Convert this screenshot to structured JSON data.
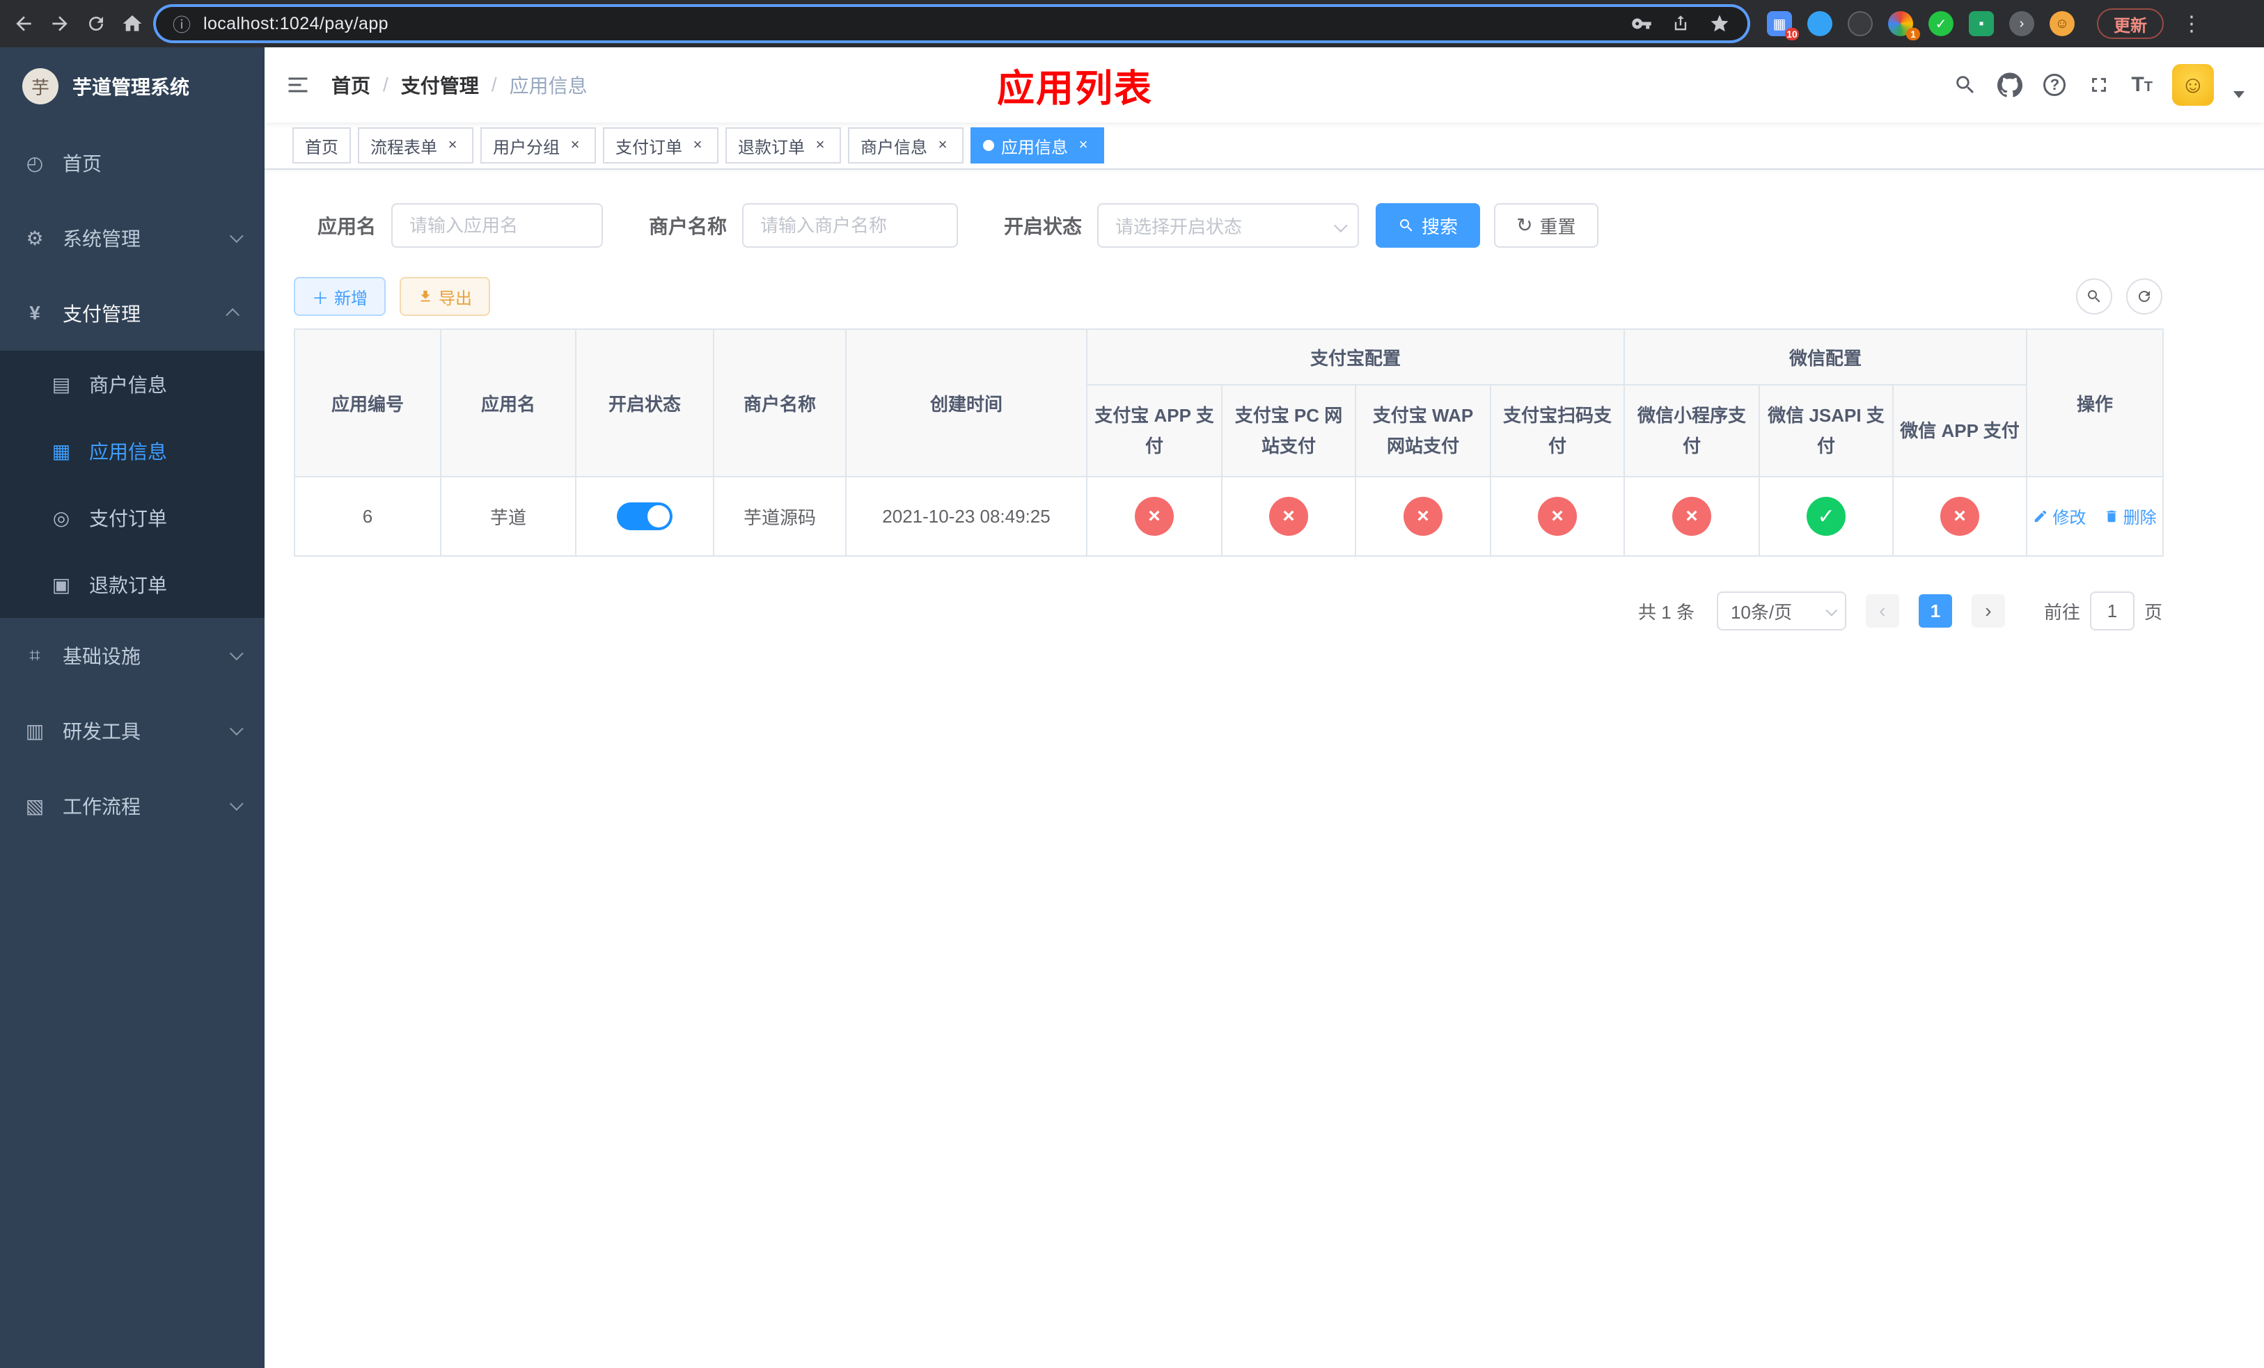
{
  "browser": {
    "url": "localhost:1024/pay/app",
    "update_label": "更新",
    "ext_badges": {
      "apps": "10",
      "profile": "1"
    }
  },
  "sidebar": {
    "title": "芋道管理系统",
    "logo_letter": "芋",
    "menu": [
      {
        "label": "首页"
      },
      {
        "label": "系统管理"
      },
      {
        "label": "支付管理"
      }
    ],
    "submenu": [
      {
        "label": "商户信息"
      },
      {
        "label": "应用信息",
        "active": true
      },
      {
        "label": "支付订单"
      },
      {
        "label": "退款订单"
      }
    ],
    "menu_bottom": [
      {
        "label": "基础设施"
      },
      {
        "label": "研发工具"
      },
      {
        "label": "工作流程"
      }
    ]
  },
  "header": {
    "breadcrumb": [
      "首页",
      "支付管理",
      "应用信息"
    ],
    "overlay_title": "应用列表"
  },
  "tabs": [
    {
      "label": "首页",
      "closable": false
    },
    {
      "label": "流程表单",
      "closable": true
    },
    {
      "label": "用户分组",
      "closable": true
    },
    {
      "label": "支付订单",
      "closable": true
    },
    {
      "label": "退款订单",
      "closable": true
    },
    {
      "label": "商户信息",
      "closable": true
    },
    {
      "label": "应用信息",
      "closable": true,
      "active": true
    }
  ],
  "filters": {
    "app_name_label": "应用名",
    "app_name_placeholder": "请输入应用名",
    "merchant_label": "商户名称",
    "merchant_placeholder": "请输入商户名称",
    "status_label": "开启状态",
    "status_placeholder": "请选择开启状态",
    "search_label": "搜索",
    "reset_label": "重置"
  },
  "toolbar": {
    "add_label": "新增",
    "export_label": "导出"
  },
  "table": {
    "group_alipay": "支付宝配置",
    "group_wechat": "微信配置",
    "columns": [
      "应用编号",
      "应用名",
      "开启状态",
      "商户名称",
      "创建时间",
      "支付宝 APP 支付",
      "支付宝 PC 网站支付",
      "支付宝 WAP 网站支付",
      "支付宝扫码支付",
      "微信小程序支付",
      "微信 JSAPI 支付",
      "微信 APP 支付",
      "操作"
    ],
    "rows": [
      {
        "id": "6",
        "name": "芋道",
        "enabled": true,
        "merchant": "芋道源码",
        "created": "2021-10-23 08:49:25",
        "configs": [
          false,
          false,
          false,
          false,
          false,
          true,
          false
        ],
        "edit_label": "修改",
        "delete_label": "删除"
      }
    ]
  },
  "pagination": {
    "total_label": "共 1 条",
    "page_size_label": "10条/页",
    "current_page": "1",
    "goto_label": "前往",
    "goto_value": "1",
    "page_suffix": "页"
  },
  "colors": {
    "accent": "#409eff",
    "status_on": "#13ce66",
    "status_off": "#f56c6c",
    "title_red": "#fe0000"
  }
}
